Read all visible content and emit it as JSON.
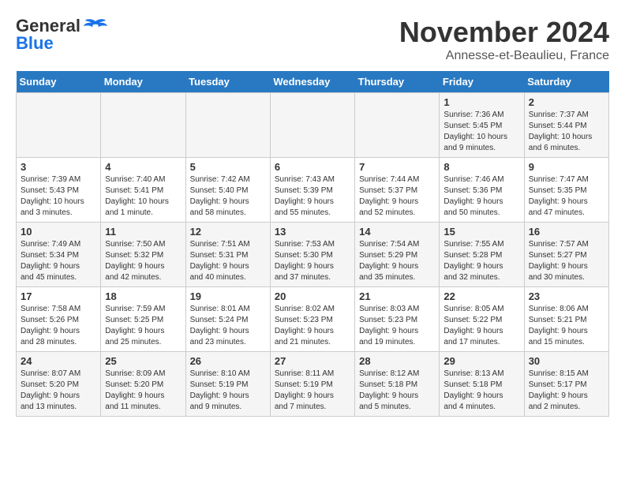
{
  "header": {
    "logo_line1": "General",
    "logo_line2": "Blue",
    "month": "November 2024",
    "location": "Annesse-et-Beaulieu, France"
  },
  "days_of_week": [
    "Sunday",
    "Monday",
    "Tuesday",
    "Wednesday",
    "Thursday",
    "Friday",
    "Saturday"
  ],
  "weeks": [
    [
      {
        "day": "",
        "info": ""
      },
      {
        "day": "",
        "info": ""
      },
      {
        "day": "",
        "info": ""
      },
      {
        "day": "",
        "info": ""
      },
      {
        "day": "",
        "info": ""
      },
      {
        "day": "1",
        "info": "Sunrise: 7:36 AM\nSunset: 5:45 PM\nDaylight: 10 hours\nand 9 minutes."
      },
      {
        "day": "2",
        "info": "Sunrise: 7:37 AM\nSunset: 5:44 PM\nDaylight: 10 hours\nand 6 minutes."
      }
    ],
    [
      {
        "day": "3",
        "info": "Sunrise: 7:39 AM\nSunset: 5:43 PM\nDaylight: 10 hours\nand 3 minutes."
      },
      {
        "day": "4",
        "info": "Sunrise: 7:40 AM\nSunset: 5:41 PM\nDaylight: 10 hours\nand 1 minute."
      },
      {
        "day": "5",
        "info": "Sunrise: 7:42 AM\nSunset: 5:40 PM\nDaylight: 9 hours\nand 58 minutes."
      },
      {
        "day": "6",
        "info": "Sunrise: 7:43 AM\nSunset: 5:39 PM\nDaylight: 9 hours\nand 55 minutes."
      },
      {
        "day": "7",
        "info": "Sunrise: 7:44 AM\nSunset: 5:37 PM\nDaylight: 9 hours\nand 52 minutes."
      },
      {
        "day": "8",
        "info": "Sunrise: 7:46 AM\nSunset: 5:36 PM\nDaylight: 9 hours\nand 50 minutes."
      },
      {
        "day": "9",
        "info": "Sunrise: 7:47 AM\nSunset: 5:35 PM\nDaylight: 9 hours\nand 47 minutes."
      }
    ],
    [
      {
        "day": "10",
        "info": "Sunrise: 7:49 AM\nSunset: 5:34 PM\nDaylight: 9 hours\nand 45 minutes."
      },
      {
        "day": "11",
        "info": "Sunrise: 7:50 AM\nSunset: 5:32 PM\nDaylight: 9 hours\nand 42 minutes."
      },
      {
        "day": "12",
        "info": "Sunrise: 7:51 AM\nSunset: 5:31 PM\nDaylight: 9 hours\nand 40 minutes."
      },
      {
        "day": "13",
        "info": "Sunrise: 7:53 AM\nSunset: 5:30 PM\nDaylight: 9 hours\nand 37 minutes."
      },
      {
        "day": "14",
        "info": "Sunrise: 7:54 AM\nSunset: 5:29 PM\nDaylight: 9 hours\nand 35 minutes."
      },
      {
        "day": "15",
        "info": "Sunrise: 7:55 AM\nSunset: 5:28 PM\nDaylight: 9 hours\nand 32 minutes."
      },
      {
        "day": "16",
        "info": "Sunrise: 7:57 AM\nSunset: 5:27 PM\nDaylight: 9 hours\nand 30 minutes."
      }
    ],
    [
      {
        "day": "17",
        "info": "Sunrise: 7:58 AM\nSunset: 5:26 PM\nDaylight: 9 hours\nand 28 minutes."
      },
      {
        "day": "18",
        "info": "Sunrise: 7:59 AM\nSunset: 5:25 PM\nDaylight: 9 hours\nand 25 minutes."
      },
      {
        "day": "19",
        "info": "Sunrise: 8:01 AM\nSunset: 5:24 PM\nDaylight: 9 hours\nand 23 minutes."
      },
      {
        "day": "20",
        "info": "Sunrise: 8:02 AM\nSunset: 5:23 PM\nDaylight: 9 hours\nand 21 minutes."
      },
      {
        "day": "21",
        "info": "Sunrise: 8:03 AM\nSunset: 5:23 PM\nDaylight: 9 hours\nand 19 minutes."
      },
      {
        "day": "22",
        "info": "Sunrise: 8:05 AM\nSunset: 5:22 PM\nDaylight: 9 hours\nand 17 minutes."
      },
      {
        "day": "23",
        "info": "Sunrise: 8:06 AM\nSunset: 5:21 PM\nDaylight: 9 hours\nand 15 minutes."
      }
    ],
    [
      {
        "day": "24",
        "info": "Sunrise: 8:07 AM\nSunset: 5:20 PM\nDaylight: 9 hours\nand 13 minutes."
      },
      {
        "day": "25",
        "info": "Sunrise: 8:09 AM\nSunset: 5:20 PM\nDaylight: 9 hours\nand 11 minutes."
      },
      {
        "day": "26",
        "info": "Sunrise: 8:10 AM\nSunset: 5:19 PM\nDaylight: 9 hours\nand 9 minutes."
      },
      {
        "day": "27",
        "info": "Sunrise: 8:11 AM\nSunset: 5:19 PM\nDaylight: 9 hours\nand 7 minutes."
      },
      {
        "day": "28",
        "info": "Sunrise: 8:12 AM\nSunset: 5:18 PM\nDaylight: 9 hours\nand 5 minutes."
      },
      {
        "day": "29",
        "info": "Sunrise: 8:13 AM\nSunset: 5:18 PM\nDaylight: 9 hours\nand 4 minutes."
      },
      {
        "day": "30",
        "info": "Sunrise: 8:15 AM\nSunset: 5:17 PM\nDaylight: 9 hours\nand 2 minutes."
      }
    ]
  ]
}
